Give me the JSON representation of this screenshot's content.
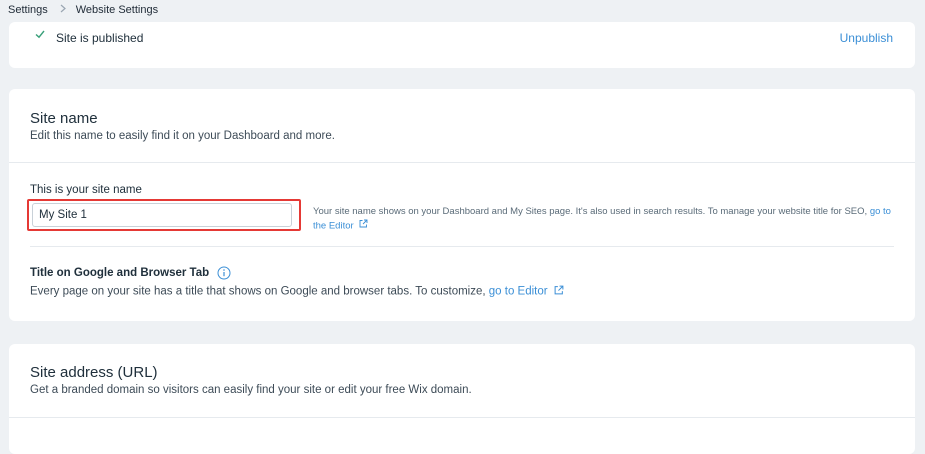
{
  "breadcrumb": {
    "root": "Settings",
    "current": "Website Settings"
  },
  "status": {
    "text": "Site is published",
    "action": "Unpublish"
  },
  "site_name_section": {
    "title": "Site name",
    "subtitle": "Edit this name to easily find it on your Dashboard and more.",
    "field_label": "This is your site name",
    "input_value": "My Site 1",
    "help_text": "Your site name shows on your Dashboard and My Sites page. It's also used in search results. To manage your website title for SEO,",
    "help_link": "go to the Editor"
  },
  "google_title_section": {
    "title": "Title on Google and Browser Tab",
    "description": "Every page on your site has a title that shows on Google and browser tabs. To customize,",
    "link": "go to Editor"
  },
  "site_address_section": {
    "title": "Site address (URL)",
    "subtitle": "Get a branded domain so visitors can easily find your site or edit your free Wix domain."
  },
  "colors": {
    "accent_link": "#3b8fd6",
    "highlight_box": "#e53935",
    "success_check": "#3aa07a"
  },
  "icons": {
    "chevron": "chevron-right-icon",
    "check": "check-icon",
    "external": "external-link-icon",
    "info": "info-icon"
  }
}
